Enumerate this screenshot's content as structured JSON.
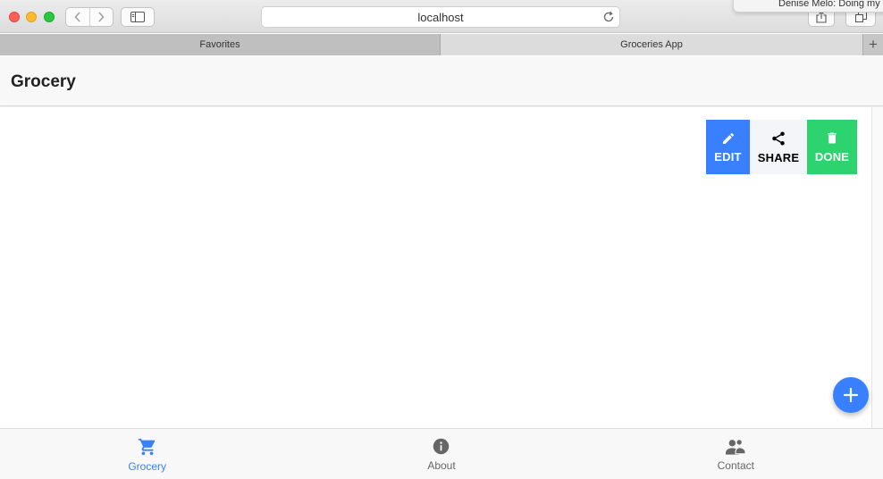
{
  "browser": {
    "url": "localhost",
    "notification_text": "Denise Melo: Doing my",
    "tabs": [
      {
        "label": "Favorites"
      },
      {
        "label": "Groceries App"
      }
    ],
    "new_tab_glyph": "+"
  },
  "app": {
    "title": "Grocery",
    "item_options": [
      {
        "label": "EDIT",
        "icon": "pencil-icon",
        "color": "#3880ff"
      },
      {
        "label": "SHARE",
        "icon": "share-icon",
        "color": "#f4f5f8"
      },
      {
        "label": "DONE",
        "icon": "trash-icon",
        "color": "#2dd36f"
      }
    ],
    "fab": {
      "icon": "add-icon",
      "color": "#3880ff"
    },
    "bottom_tabs": [
      {
        "label": "Grocery",
        "icon": "cart-icon",
        "selected": true
      },
      {
        "label": "About",
        "icon": "info-icon",
        "selected": false
      },
      {
        "label": "Contact",
        "icon": "people-icon",
        "selected": false
      }
    ]
  },
  "colors": {
    "primary": "#3880ff",
    "success": "#2dd36f",
    "light": "#f4f5f8"
  }
}
